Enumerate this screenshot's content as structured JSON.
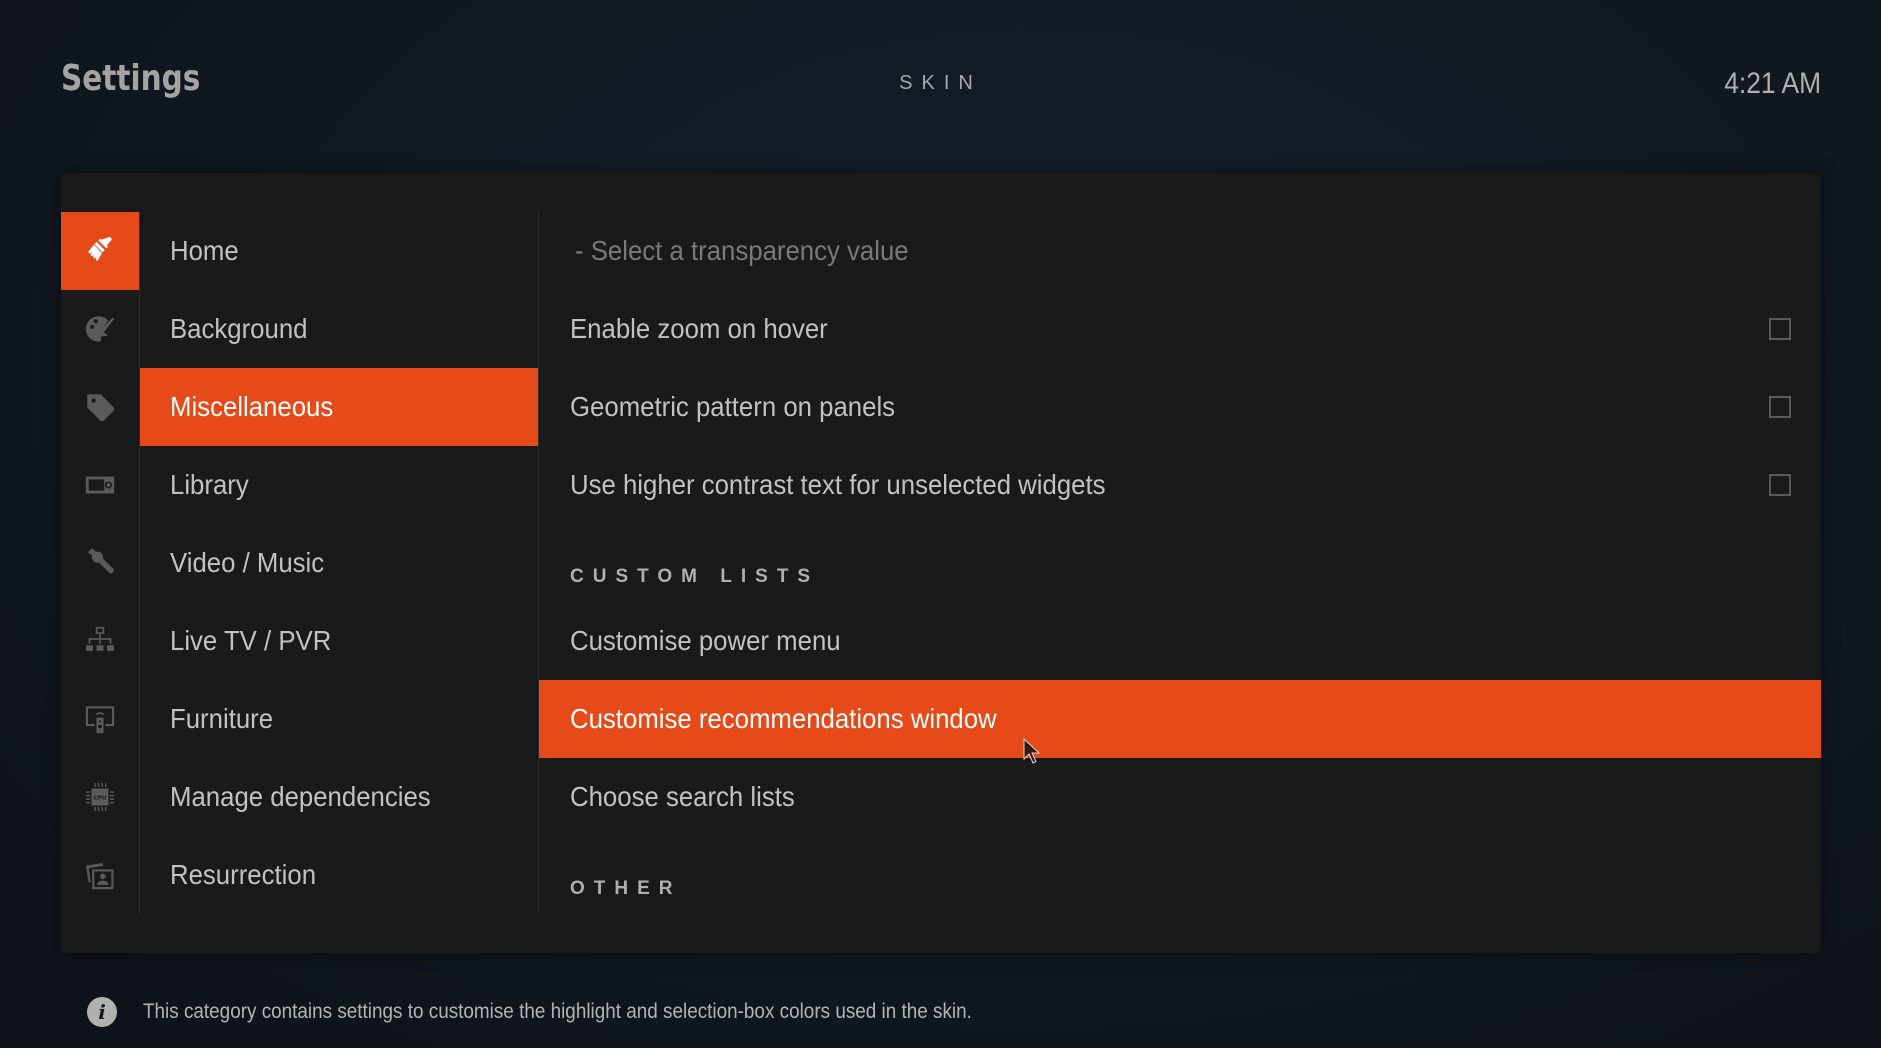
{
  "header": {
    "title": "Settings",
    "section": "SKIN",
    "clock": "4:21 AM"
  },
  "sidebar": {
    "selected_index": 2,
    "items": [
      {
        "label": "Home",
        "icon": "paintbrush-icon",
        "active_icon": true
      },
      {
        "label": "Background",
        "icon": "palette-icon"
      },
      {
        "label": "Miscellaneous",
        "icon": "tag-icon"
      },
      {
        "label": "Library",
        "icon": "radio-device-icon"
      },
      {
        "label": "Video / Music",
        "icon": "wrench-icon"
      },
      {
        "label": "Live TV / PVR",
        "icon": "network-hierarchy-icon"
      },
      {
        "label": "Furniture",
        "icon": "remote-screen-icon"
      },
      {
        "label": "Manage dependencies",
        "icon": "cpu-chip-icon"
      },
      {
        "label": "Resurrection",
        "icon": "photo-album-icon"
      }
    ]
  },
  "main": {
    "rows": [
      {
        "type": "sub-option",
        "label": "- Select a transparency value"
      },
      {
        "type": "toggle",
        "label": "Enable zoom on hover",
        "checked": false
      },
      {
        "type": "toggle",
        "label": "Geometric pattern on panels",
        "checked": false
      },
      {
        "type": "toggle",
        "label": "Use higher contrast text for unselected widgets",
        "checked": false
      },
      {
        "type": "header",
        "label": "CUSTOM LISTS"
      },
      {
        "type": "action",
        "label": "Customise power menu"
      },
      {
        "type": "action",
        "label": "Customise recommendations window",
        "focused": true
      },
      {
        "type": "action",
        "label": "Choose search lists"
      },
      {
        "type": "header",
        "label": "OTHER"
      }
    ]
  },
  "footer": {
    "info_icon": "info-icon",
    "description": "This category contains settings to customise the highlight and selection-box colors used in the skin."
  },
  "colors": {
    "accent": "#e64a19",
    "panel": "#1a1a1a",
    "text": "#c2c2c2"
  }
}
